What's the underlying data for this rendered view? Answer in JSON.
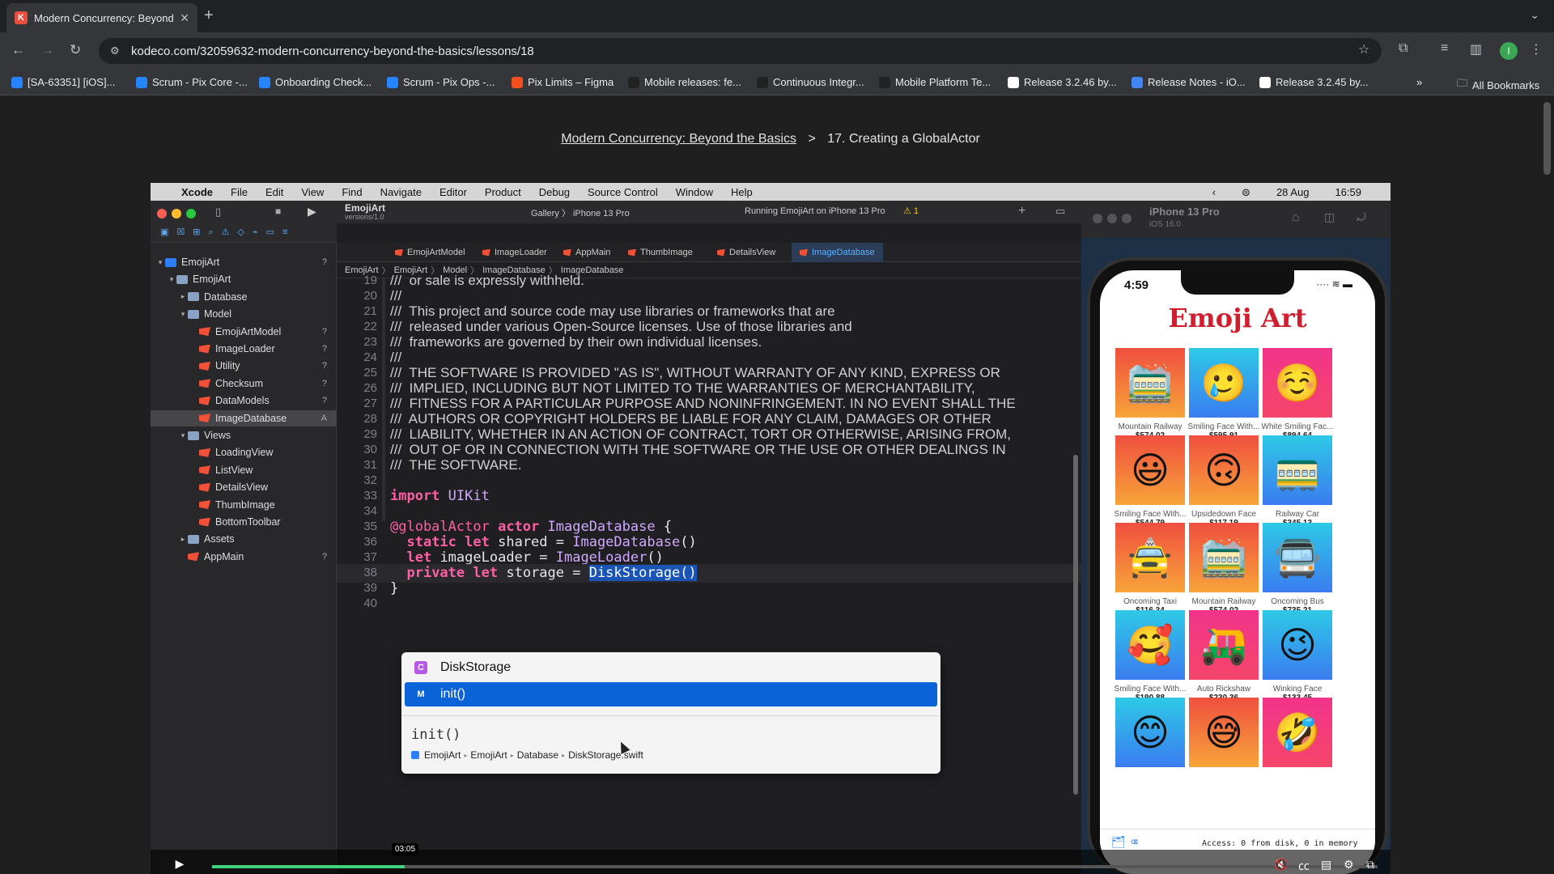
{
  "browser": {
    "tab_title": "Modern Concurrency: Beyond",
    "favicon_letter": "K",
    "url": "kodeco.com/32059632-modern-concurrency-beyond-the-basics/lessons/18",
    "profile_initial": "I",
    "bookmarks": [
      {
        "label": "[SA-63351] [iOS]...",
        "icon": "jira-icon",
        "color": "#2684ff"
      },
      {
        "label": "Scrum - Pix Core -...",
        "icon": "jira-icon",
        "color": "#2684ff"
      },
      {
        "label": "Onboarding Check...",
        "icon": "confluence-icon",
        "color": "#2684ff"
      },
      {
        "label": "Scrum - Pix Ops -...",
        "icon": "jira-icon",
        "color": "#2684ff"
      },
      {
        "label": "Pix Limits – Figma",
        "icon": "figma-icon",
        "color": "#f24e1e"
      },
      {
        "label": "Mobile releases: fe...",
        "icon": "rwy-icon",
        "color": "#222222"
      },
      {
        "label": "Continuous Integr...",
        "icon": "rwy-icon",
        "color": "#222222"
      },
      {
        "label": "Mobile Platform Te...",
        "icon": "rwy-icon",
        "color": "#222222"
      },
      {
        "label": "Release 3.2.46 by...",
        "icon": "github-icon",
        "color": "#ffffff"
      },
      {
        "label": "Release Notes - iO...",
        "icon": "docs-icon",
        "color": "#4285f4"
      },
      {
        "label": "Release 3.2.45 by...",
        "icon": "github-icon",
        "color": "#ffffff"
      }
    ],
    "all_bookmarks": "All Bookmarks"
  },
  "breadcrumb": {
    "course": "Modern Concurrency: Beyond the Basics",
    "separator": ">",
    "lesson": "17. Creating a GlobalActor"
  },
  "mac_menubar": {
    "app": "Xcode",
    "items": [
      "File",
      "Edit",
      "View",
      "Find",
      "Navigate",
      "Editor",
      "Product",
      "Debug",
      "Source Control",
      "Window",
      "Help"
    ],
    "date": "28 Aug",
    "time": "16:59"
  },
  "xcode": {
    "project_name": "EmojiArt",
    "project_version": "versions/1.0",
    "scheme": "Gallery",
    "device": "iPhone 13 Pro",
    "status": "Running EmojiArt on iPhone 13 Pro",
    "warning_count": "1",
    "tabs": [
      "EmojiArtModel",
      "ImageLoader",
      "AppMain",
      "ThumbImage",
      "DetailsView",
      "ImageDatabase"
    ],
    "active_tab": "ImageDatabase",
    "jumpbar": [
      "EmojiArt",
      "EmojiArt",
      "Model",
      "ImageDatabase",
      "ImageDatabase"
    ],
    "navigator": [
      {
        "label": "EmojiArt",
        "indent": 0,
        "kind": "proj",
        "disc": "v",
        "badge": "?"
      },
      {
        "label": "EmojiArt",
        "indent": 1,
        "kind": "folder",
        "disc": "v",
        "badge": ""
      },
      {
        "label": "Database",
        "indent": 2,
        "kind": "folder",
        "disc": ">",
        "badge": ""
      },
      {
        "label": "Model",
        "indent": 2,
        "kind": "folder",
        "disc": "v",
        "badge": ""
      },
      {
        "label": "EmojiArtModel",
        "indent": 3,
        "kind": "swift",
        "disc": "",
        "badge": "?"
      },
      {
        "label": "ImageLoader",
        "indent": 3,
        "kind": "swift",
        "disc": "",
        "badge": "?"
      },
      {
        "label": "Utility",
        "indent": 3,
        "kind": "swift",
        "disc": "",
        "badge": "?"
      },
      {
        "label": "Checksum",
        "indent": 3,
        "kind": "swift",
        "disc": "",
        "badge": "?"
      },
      {
        "label": "DataModels",
        "indent": 3,
        "kind": "swift",
        "disc": "",
        "badge": "?"
      },
      {
        "label": "ImageDatabase",
        "indent": 3,
        "kind": "swift",
        "disc": "",
        "badge": "A",
        "selected": true
      },
      {
        "label": "Views",
        "indent": 2,
        "kind": "folder",
        "disc": "v",
        "badge": ""
      },
      {
        "label": "LoadingView",
        "indent": 3,
        "kind": "swift",
        "disc": "",
        "badge": ""
      },
      {
        "label": "ListView",
        "indent": 3,
        "kind": "swift",
        "disc": "",
        "badge": ""
      },
      {
        "label": "DetailsView",
        "indent": 3,
        "kind": "swift",
        "disc": "",
        "badge": ""
      },
      {
        "label": "ThumbImage",
        "indent": 3,
        "kind": "swift",
        "disc": "",
        "badge": ""
      },
      {
        "label": "BottomToolbar",
        "indent": 3,
        "kind": "swift",
        "disc": "",
        "badge": ""
      },
      {
        "label": "Assets",
        "indent": 2,
        "kind": "folder",
        "disc": ">",
        "badge": ""
      },
      {
        "label": "AppMain",
        "indent": 2,
        "kind": "swift",
        "disc": "",
        "badge": "?"
      }
    ],
    "code_lines": [
      {
        "n": "19",
        "text": "///  or sale is expressly withheld.",
        "type": "comment"
      },
      {
        "n": "20",
        "text": "///",
        "type": "comment"
      },
      {
        "n": "21",
        "text": "///  This project and source code may use libraries or frameworks that are",
        "type": "comment"
      },
      {
        "n": "22",
        "text": "///  released under various Open-Source licenses. Use of those libraries and",
        "type": "comment"
      },
      {
        "n": "23",
        "text": "///  frameworks are governed by their own individual licenses.",
        "type": "comment"
      },
      {
        "n": "24",
        "text": "///",
        "type": "comment"
      },
      {
        "n": "25",
        "text": "///  THE SOFTWARE IS PROVIDED \"AS IS\", WITHOUT WARRANTY OF ANY KIND, EXPRESS OR",
        "type": "comment"
      },
      {
        "n": "26",
        "text": "///  IMPLIED, INCLUDING BUT NOT LIMITED TO THE WARRANTIES OF MERCHANTABILITY,",
        "type": "comment"
      },
      {
        "n": "27",
        "text": "///  FITNESS FOR A PARTICULAR PURPOSE AND NONINFRINGEMENT. IN NO EVENT SHALL THE",
        "type": "comment"
      },
      {
        "n": "28",
        "text": "///  AUTHORS OR COPYRIGHT HOLDERS BE LIABLE FOR ANY CLAIM, DAMAGES OR OTHER",
        "type": "comment"
      },
      {
        "n": "29",
        "text": "///  LIABILITY, WHETHER IN AN ACTION OF CONTRACT, TORT OR OTHERWISE, ARISING FROM,",
        "type": "comment"
      },
      {
        "n": "30",
        "text": "///  OUT OF OR IN CONNECTION WITH THE SOFTWARE OR THE USE OR OTHER DEALINGS IN",
        "type": "comment"
      },
      {
        "n": "31",
        "text": "///  THE SOFTWARE.",
        "type": "comment"
      },
      {
        "n": "32",
        "text": "",
        "type": "code"
      },
      {
        "n": "33",
        "text": "import UIKit",
        "type": "code"
      },
      {
        "n": "34",
        "text": "",
        "type": "code"
      },
      {
        "n": "35",
        "text": "@globalActor actor ImageDatabase {",
        "type": "code"
      },
      {
        "n": "36",
        "text": "  static let shared = ImageDatabase()",
        "type": "code"
      },
      {
        "n": "37",
        "text": "  let imageLoader = ImageLoader()",
        "type": "code"
      },
      {
        "n": "38",
        "text": "  private let storage = DiskStorage()",
        "type": "code",
        "current": true
      },
      {
        "n": "39",
        "text": "}",
        "type": "code"
      },
      {
        "n": "40",
        "text": "",
        "type": "code"
      }
    ],
    "autocomplete": {
      "items": [
        {
          "badge": "C",
          "label": "DiskStorage",
          "badge_color": "#b857e5"
        },
        {
          "badge": "M",
          "label": "init()",
          "badge_color": "#0a64d8",
          "selected": true
        }
      ],
      "signature": "init()",
      "path": [
        "EmojiArt",
        "EmojiArt",
        "Database",
        "DiskStorage.swift"
      ]
    }
  },
  "simulator": {
    "device": "iPhone 13 Pro",
    "os": "iOS 16.0",
    "time": "4:59",
    "app_title": "Emoji Art",
    "items": [
      {
        "emoji": "🚞",
        "name": "Mountain Railway",
        "price": "$574.02",
        "colors": [
          "#f04f3e",
          "#f7a43a"
        ]
      },
      {
        "emoji": "🥲",
        "name": "Smiling Face With...",
        "price": "$595.91",
        "colors": [
          "#2ec9e6",
          "#3a7cf0"
        ]
      },
      {
        "emoji": "☺️",
        "name": "White Smiling Fac...",
        "price": "$894.64",
        "colors": [
          "#f2348a",
          "#f5456a"
        ]
      },
      {
        "emoji": "😃",
        "name": "Smiling Face With...",
        "price": "$544.79",
        "colors": [
          "#f04f3e",
          "#f7a43a"
        ]
      },
      {
        "emoji": "🙃",
        "name": "Upsidedown Face",
        "price": "$117.19",
        "colors": [
          "#f04f3e",
          "#f7a43a"
        ]
      },
      {
        "emoji": "🚃",
        "name": "Railway Car",
        "price": "$345.13",
        "colors": [
          "#2ec9e6",
          "#3a7cf0"
        ]
      },
      {
        "emoji": "🚖",
        "name": "Oncoming Taxi",
        "price": "$116.34",
        "colors": [
          "#f04f3e",
          "#f7a43a"
        ]
      },
      {
        "emoji": "🚞",
        "name": "Mountain Railway",
        "price": "$574.02",
        "colors": [
          "#f04f3e",
          "#f7a43a"
        ]
      },
      {
        "emoji": "🚍",
        "name": "Oncoming Bus",
        "price": "$735.21",
        "colors": [
          "#2ec9e6",
          "#3a7cf0"
        ]
      },
      {
        "emoji": "🥰",
        "name": "Smiling Face With...",
        "price": "$190.88",
        "colors": [
          "#2ec9e6",
          "#3a7cf0"
        ]
      },
      {
        "emoji": "🛺",
        "name": "Auto Rickshaw",
        "price": "$230.36",
        "colors": [
          "#f2348a",
          "#f5456a"
        ]
      },
      {
        "emoji": "😉",
        "name": "Winking Face",
        "price": "$133.45",
        "colors": [
          "#2ec9e6",
          "#3a7cf0"
        ]
      },
      {
        "emoji": "😊",
        "name": "",
        "price": "",
        "colors": [
          "#2ec9e6",
          "#3a7cf0"
        ]
      },
      {
        "emoji": "😅",
        "name": "",
        "price": "",
        "colors": [
          "#f04f3e",
          "#f7a43a"
        ]
      },
      {
        "emoji": "🤣",
        "name": "",
        "price": "",
        "colors": [
          "#f2348a",
          "#f5456a"
        ]
      }
    ],
    "footer_text": "Access: 0 from disk, 0 in memory"
  },
  "video": {
    "time_tooltip": "03:05",
    "progress": 0.165
  }
}
